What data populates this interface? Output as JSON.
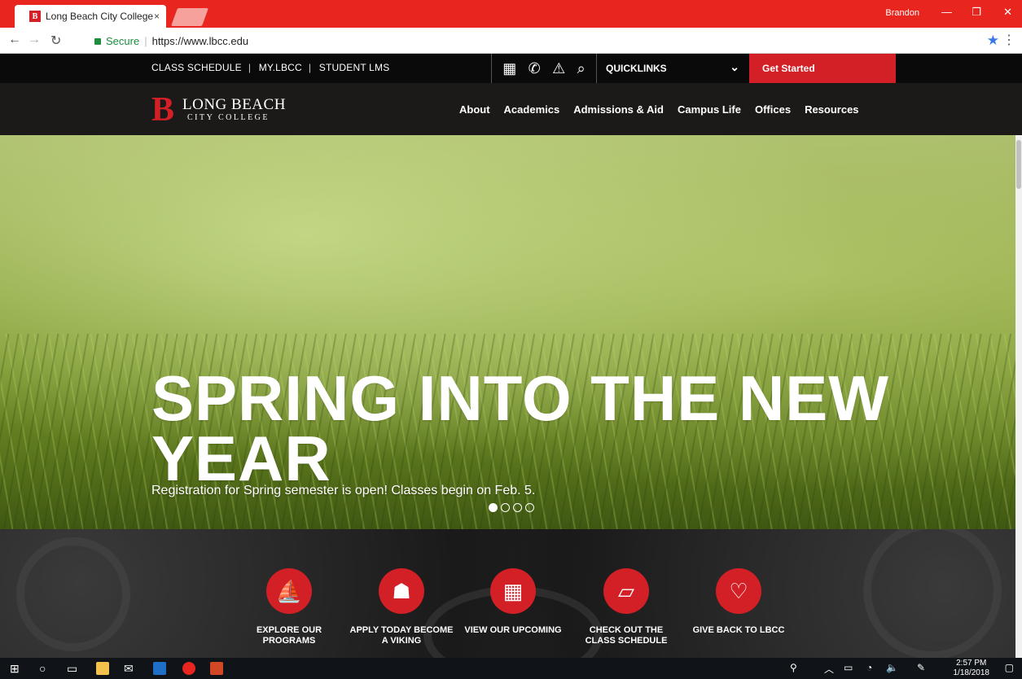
{
  "browser": {
    "tab_title": "Long Beach City College",
    "tab_close": "×",
    "user": "Brandon",
    "secure_label": "Secure",
    "url": "https://www.lbcc.edu"
  },
  "utility": {
    "links": [
      "CLASS SCHEDULE",
      "MY.LBCC",
      "STUDENT LMS"
    ],
    "icons": [
      "calendar-icon",
      "phone-icon",
      "alert-icon",
      "search-icon"
    ],
    "quicklinks": "QUICKLINKS",
    "get_started": "Get Started"
  },
  "logo": {
    "mark": "B",
    "line1": "LONG BEACH",
    "line2": "CITY COLLEGE"
  },
  "nav": [
    "About",
    "Academics",
    "Admissions & Aid",
    "Campus Life",
    "Offices",
    "Resources"
  ],
  "hero": {
    "title": "SPRING INTO THE NEW YEAR",
    "subtitle": "Registration for Spring semester is open! Classes begin on Feb. 5.",
    "slide_count": 4,
    "active_slide": 1
  },
  "features": [
    {
      "icon": "viking-ship-icon",
      "label": "EXPLORE OUR PROGRAMS"
    },
    {
      "icon": "viking-helmet-icon",
      "label": "APPLY TODAY BECOME A VIKING"
    },
    {
      "icon": "calendar-icon",
      "label": "VIEW OUR UPCOMING"
    },
    {
      "icon": "book-icon",
      "label": "CHECK OUT THE CLASS SCHEDULE"
    },
    {
      "icon": "heart-hands-icon",
      "label": "GIVE BACK TO LBCC"
    }
  ],
  "taskbar": {
    "time": "2:57 PM",
    "date": "1/18/2018"
  },
  "colors": {
    "brand_red": "#d31f26",
    "chrome_red": "#e8261f"
  }
}
